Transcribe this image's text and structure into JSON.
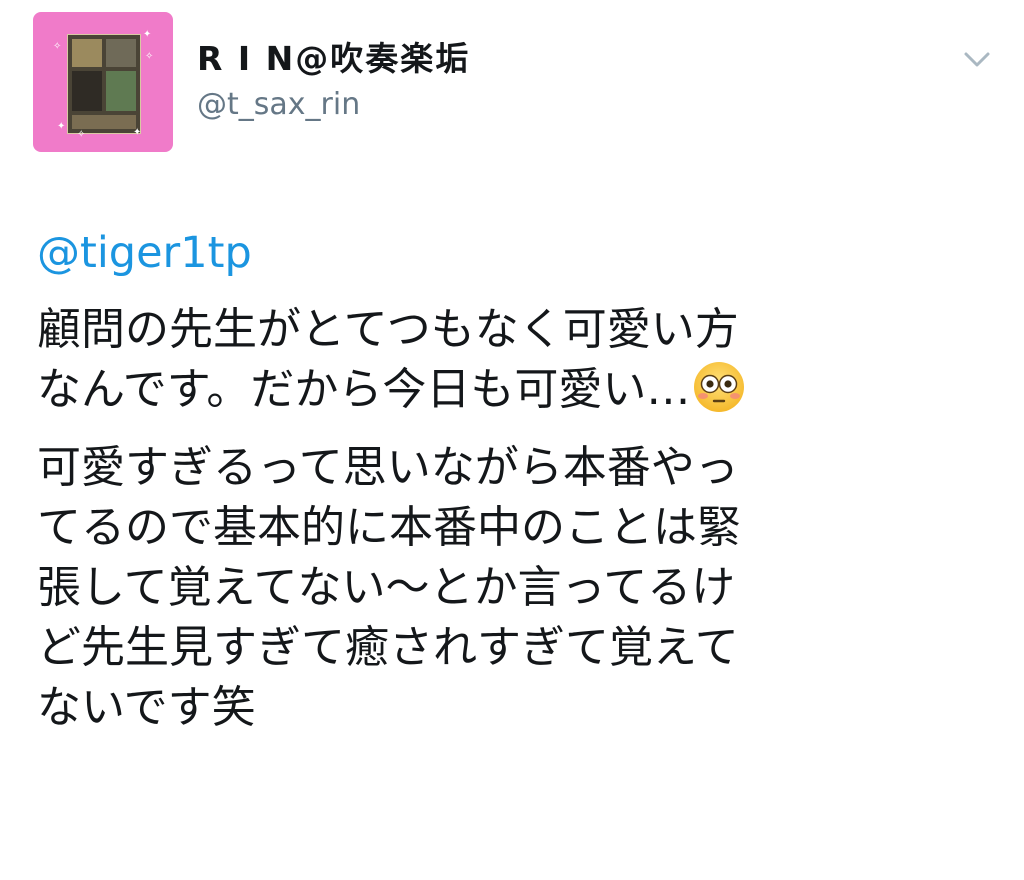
{
  "tweet": {
    "display_name": "R I N@吹奏楽垢",
    "handle": "@t_sax_rin",
    "mention": "@tiger1tp",
    "paragraph1": "顧問の先生がとてつもなく可愛い方\nなんです。だから今日も可愛い…",
    "emoji": "flushed-face",
    "paragraph2": "可愛すぎるって思いながら本番やっ\nてるので基本的に本番中のことは緊\n張して覚えてない〜とか言ってるけ\nど先生見すぎて癒されすぎて覚えて\nないです笑"
  },
  "colors": {
    "link": "#1b95e0",
    "secondary_text": "#657786",
    "avatar_background": "#f07bc9"
  }
}
